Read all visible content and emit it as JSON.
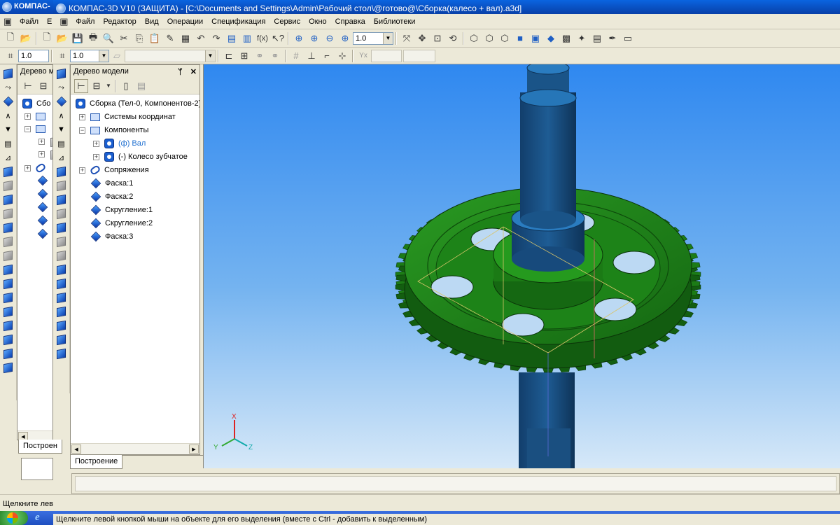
{
  "window": {
    "back_title": "КОМПАС-",
    "title": "КОМПАС-3D V10 (ЗАЩИТА) - [C:\\Documents and Settings\\Admin\\Рабочий стол\\@готово@\\Сборка(калесо + вал).a3d]"
  },
  "menu": {
    "back_items": [
      "Файл",
      "Е"
    ],
    "items": [
      "Файл",
      "Редактор",
      "Вид",
      "Операции",
      "Спецификация",
      "Сервис",
      "Окно",
      "Справка",
      "Библиотеки"
    ]
  },
  "toolbar": {
    "zoom_value": "1.0",
    "step_value_back": "1.0",
    "step_value": "1.0"
  },
  "panels": {
    "back_header": "Дерево мод",
    "back_tree_root": "Сбо",
    "back_tab": "Построен",
    "header": "Дерево модели",
    "pin_glyph": "ᛘ",
    "close_glyph": "✕",
    "tab": "Построение"
  },
  "tree": {
    "root": "Сборка (Тел-0, Компонентов-2)",
    "coordinate_systems": "Системы координат",
    "components": "Компоненты",
    "component_1": "(ф) Вал",
    "component_2": "(-) Колесо зубчатое",
    "mates": "Сопряжения",
    "operations": [
      "Фаска:1",
      "Фаска:2",
      "Скругление:1",
      "Скругление:2",
      "Фаска:3"
    ]
  },
  "viewport": {
    "axis_x": "X",
    "axis_y": "Y",
    "axis_z": "Z",
    "colors": {
      "gear": "#1f8a1a",
      "shaft": "#1d5c96",
      "shaft_top": "#2a7cc0"
    }
  },
  "status": {
    "back_hint": "Щелкните левой",
    "hint": "Щелкните левой кнопкой мыши на объекте для его выделения (вместе с Ctrl - добавить к выделенным)"
  },
  "colors": {
    "title_bar": "#0a5fd8",
    "chrome": "#ece9d8",
    "accent": "#1f6fd0"
  }
}
